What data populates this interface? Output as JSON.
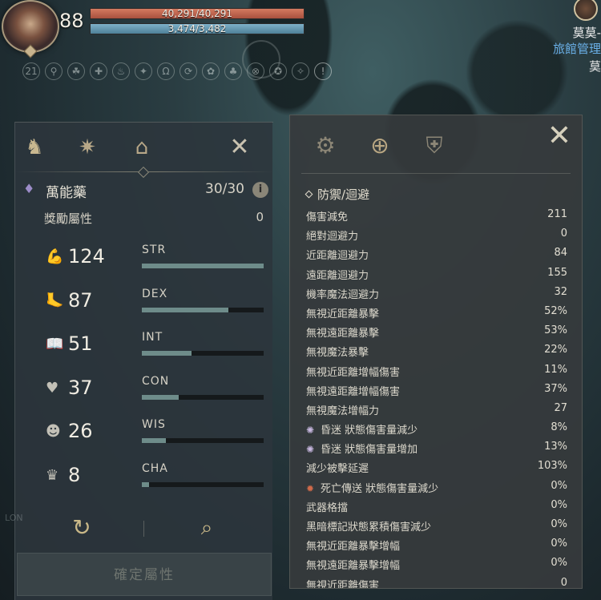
{
  "hud": {
    "level": "88",
    "hp": "40,291/40,291",
    "hp_fraction": 1.0,
    "mp": "3,474/3,482",
    "mp_fraction": 0.9977,
    "buffs": [
      "21",
      "⚲",
      "☘",
      "✚",
      "♨",
      "✦",
      "Ω",
      "⟳",
      "✿",
      "♣",
      "⊗",
      "✪",
      "✧",
      "!"
    ]
  },
  "npc": {
    "name": "莫莫-",
    "title": "旅館管理",
    "extra": "莫"
  },
  "left_panel": {
    "tabs": [
      {
        "icon": "helmet-icon",
        "glyph": "♞"
      },
      {
        "icon": "compass-star-icon",
        "glyph": "✷"
      },
      {
        "icon": "house-icon",
        "glyph": "⌂"
      }
    ],
    "close_glyph": "✕",
    "potion": {
      "icon": "potion-icon",
      "glyph": "♦",
      "name": "萬能藥",
      "count": "30/30",
      "info_glyph": "i"
    },
    "bonus": {
      "label": "獎勵屬性",
      "value": "0"
    },
    "attributes": [
      {
        "name": "STR",
        "value": "124",
        "icon": "arm-icon",
        "glyph": "💪",
        "fill": 1.0
      },
      {
        "name": "DEX",
        "value": "87",
        "icon": "foot-icon",
        "glyph": "🦶",
        "fill": 0.71
      },
      {
        "name": "INT",
        "value": "51",
        "icon": "book-icon",
        "glyph": "📖",
        "fill": 0.41
      },
      {
        "name": "CON",
        "value": "37",
        "icon": "heart-icon",
        "glyph": "♥",
        "fill": 0.3
      },
      {
        "name": "WIS",
        "value": "26",
        "icon": "head-icon",
        "glyph": "☻",
        "fill": 0.2
      },
      {
        "name": "CHA",
        "value": "8",
        "icon": "crown-icon",
        "glyph": "♛",
        "fill": 0.06
      }
    ],
    "reset_glyph": "↻",
    "search_glyph": "⌕",
    "confirm_label": "確定屬性",
    "side_label": "LON"
  },
  "right_panel": {
    "tabs": [
      {
        "icon": "helmet-gear-icon",
        "glyph": "⚙"
      },
      {
        "icon": "helmet-plus-icon",
        "glyph": "⊕"
      },
      {
        "icon": "helmet-shield-icon",
        "glyph": "⛨"
      }
    ],
    "close_glyph": "✕",
    "section_title": "防禦/迴避",
    "stats": [
      {
        "label": "傷害減免",
        "value": "211"
      },
      {
        "label": "絕對迴避力",
        "value": "0"
      },
      {
        "label": "近距離迴避力",
        "value": "84"
      },
      {
        "label": "遠距離迴避力",
        "value": "155"
      },
      {
        "label": "機率魔法迴避力",
        "value": "32"
      },
      {
        "label": "無視近距離暴擊",
        "value": "52%"
      },
      {
        "label": "無視遠距離暴擊",
        "value": "53%"
      },
      {
        "label": "無視魔法暴擊",
        "value": "22%"
      },
      {
        "label": "無視近距離增幅傷害",
        "value": "11%"
      },
      {
        "label": "無視遠距離增幅傷害",
        "value": "37%"
      },
      {
        "label": "無視魔法增幅力",
        "value": "27"
      },
      {
        "label": "昏迷 狀態傷害量減少",
        "value": "8%",
        "icon": "stun-icon",
        "glyph": "✺"
      },
      {
        "label": "昏迷 狀態傷害量增加",
        "value": "13%",
        "icon": "stun-icon",
        "glyph": "✺"
      },
      {
        "label": "減少被擊延遲",
        "value": "103%"
      },
      {
        "label": "死亡傳送 狀態傷害量減少",
        "value": "0%",
        "icon": "death-teleport-icon",
        "glyph": "✹",
        "red": true
      },
      {
        "label": "武器格擋",
        "value": "0%"
      },
      {
        "label": "黑暗標記狀態累積傷害減少",
        "value": "0%"
      },
      {
        "label": "無視近距離暴擊增幅",
        "value": "0%"
      },
      {
        "label": "無視遠距離暴擊增幅",
        "value": "0%"
      },
      {
        "label": "無視近距離傷害",
        "value": "0"
      }
    ]
  }
}
